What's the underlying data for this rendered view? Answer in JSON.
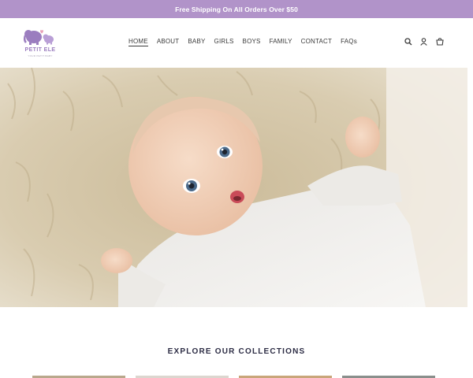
{
  "announcement": "Free Shipping On All Orders Over $50",
  "logo": {
    "brand": "PETIT ELE",
    "tagline": "YOUR PETIT BABY"
  },
  "nav": [
    {
      "label": "HOME",
      "active": true
    },
    {
      "label": "ABOUT"
    },
    {
      "label": "BABY"
    },
    {
      "label": "GIRLS"
    },
    {
      "label": "BOYS"
    },
    {
      "label": "FAMILY"
    },
    {
      "label": "CONTACT"
    },
    {
      "label": "FAQs"
    }
  ],
  "header_icons": [
    "search-icon",
    "account-icon",
    "cart-icon"
  ],
  "hero": {
    "image": "baby-lying-on-fur-rug"
  },
  "section_title": "EXPLORE OUR COLLECTIONS",
  "colors": {
    "announcement_bg": "#b193c9",
    "brand_purple": "#9b7dbf"
  }
}
